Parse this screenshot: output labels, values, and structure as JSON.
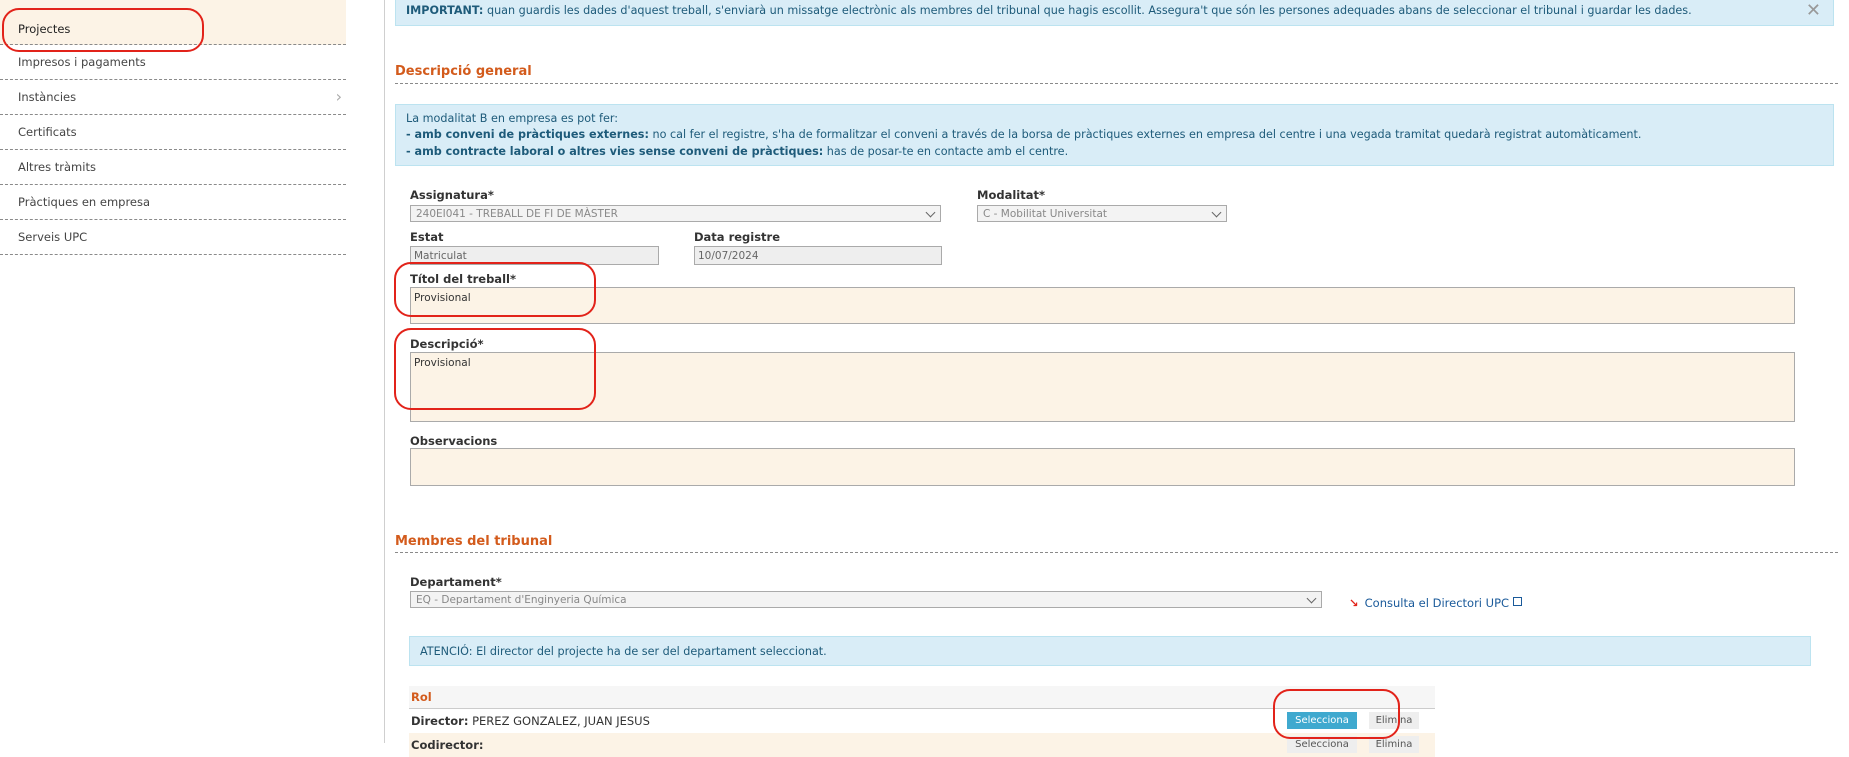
{
  "sidebar": {
    "items": [
      {
        "label": "Projectes"
      },
      {
        "label": "Impresos i pagaments"
      },
      {
        "label": "Instàncies"
      },
      {
        "label": "Certificats"
      },
      {
        "label": "Altres tràmits"
      },
      {
        "label": "Pràctiques en empresa"
      },
      {
        "label": "Serveis UPC"
      }
    ]
  },
  "top_alert": {
    "strong": "IMPORTANT:",
    "text": " quan guardis les dades d'aquest treball, s'enviarà un missatge electrònic als membres del tribunal que hagis escollit. Assegura't que són les persones adequades abans de seleccionar el tribunal i guardar les dades.",
    "close": "✕"
  },
  "general": {
    "title": "Descripció general",
    "info": {
      "line1": "La modalitat B en empresa es pot fer:",
      "line2_strong": "- amb conveni de pràctiques externes:",
      "line2_text": " no cal fer el registre, s'ha de formalitzar el conveni a través de la borsa de pràctiques externes en empresa del centre i una vegada tramitat quedarà registrat automàticament.",
      "line3_strong": "- amb contracte laboral o altres vies sense conveni de pràctiques:",
      "line3_text": " has de posar-te en contacte amb el centre."
    },
    "assignatura": {
      "label": "Assignatura*",
      "value": "240EI041 - TREBALL DE FI DE MÀSTER"
    },
    "modalitat": {
      "label": "Modalitat*",
      "value": "C - Mobilitat Universitat"
    },
    "estat": {
      "label": "Estat",
      "value": "Matriculat"
    },
    "data_registre": {
      "label": "Data registre",
      "value": "10/07/2024"
    },
    "titol": {
      "label": "Títol del treball*",
      "value": "Provisional"
    },
    "descripcio": {
      "label": "Descripció*",
      "value": "Provisional"
    },
    "observacions": {
      "label": "Observacions",
      "value": ""
    }
  },
  "tribunal": {
    "title": "Membres del tribunal",
    "departament": {
      "label": "Departament*",
      "value": "EQ - Departament d'Enginyeria Química"
    },
    "directori_link": "Consulta el Directori UPC",
    "atencio": "ATENCIÓ: El director del projecte ha de ser del departament seleccionat.",
    "rol_header": "Rol",
    "rows": [
      {
        "role": "Director:",
        "name": " PEREZ GONZALEZ, JUAN JESUS",
        "select": "Selecciona",
        "delete": "Elimina"
      },
      {
        "role": "Codirector:",
        "name": "",
        "select": "Selecciona",
        "delete": "Elimina"
      }
    ]
  }
}
